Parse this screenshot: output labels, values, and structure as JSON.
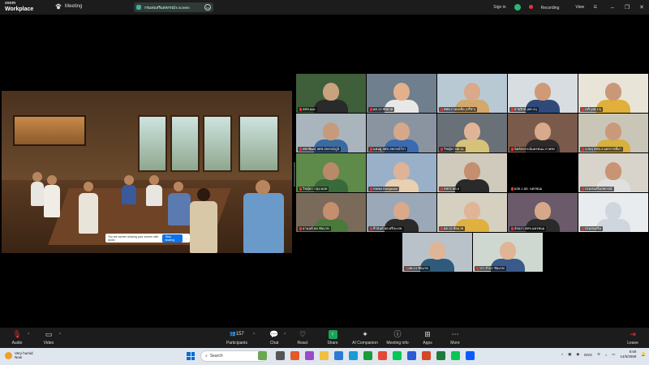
{
  "app": {
    "logo_line1": "zoom",
    "logo_line2": "Workplace",
    "meeting_tab": "Meeting",
    "share_pill_label": "กรมส่งเสริมสหกรณ์'s screen",
    "sign_in": "Sign in",
    "recording": "Recording",
    "view": "View"
  },
  "share_banner": {
    "message": "You are screen sharing your screen with audio",
    "stop_label": "Stop sharing",
    "extra": "..."
  },
  "participants": [
    {
      "name": "สศช.นผะ",
      "skin": "#c9a27e",
      "shirt": "#2a2a2a",
      "bg": "#3f5e3a"
    },
    {
      "name": "ผต.13 ชัยนาท",
      "skin": "#e2b08c",
      "shirt": "#e8e8e8",
      "bg": "#6f7f8e"
    },
    {
      "name": "ศพพ.ภาคเหนือ (ปรีชา)",
      "skin": "#d9a98a",
      "shirt": "#d4a86a",
      "bg": "#b9c9d4"
    },
    {
      "name": "สายรักษ์ (ผต.11)",
      "skin": "#d09a76",
      "shirt": "#2f4a7a",
      "bg": "#d8dde2"
    },
    {
      "name": "เบริ (ผต.13)",
      "skin": "#c99878",
      "shirt": "#e0b03a",
      "bg": "#e8e4d8"
    },
    {
      "name": "พชรพัฒน์ สศช.สหกรณ์ภูมิ",
      "skin": "#c79a7b",
      "shirt": "#3a6aa0",
      "bg": "#a9b4bd"
    },
    {
      "name": "แคนยู สศข.สหกรณ์วิรา",
      "skin": "#d6a889",
      "shirt": "#3a6ab0",
      "bg": "#8a94a0"
    },
    {
      "name": "วิชญ์ดา ผต.11",
      "skin": "#e0b496",
      "shirt": "#d7c27a",
      "bg": "#6a7078"
    },
    {
      "name": "นิตย์สหกรณ์นครพนม ภาคพร",
      "skin": "#d8a98a",
      "shirt": "#2e2a2a",
      "bg": "#7a5a4a"
    },
    {
      "name": "นายสุ สศข.4 นครราชสีมา",
      "skin": "#c99a7a",
      "shirt": "#d8b040",
      "bg": "#c9c6b8"
    },
    {
      "name": "วิชญ์ดา กลุ่ม.ผอท",
      "skin": "#b88a6a",
      "shirt": "#3a6a3a",
      "bg": "#5e8a4a"
    },
    {
      "name": "Kikitta Dongsoon",
      "skin": "#dfb397",
      "shirt": "#e8d0b0",
      "bg": "#9ab0c9"
    },
    {
      "name": "สหกร ผต.6",
      "skin": "#c48f6e",
      "shirt": "#2a2a2a",
      "bg": "#cfcabc"
    },
    {
      "name": "ผสธ.1 ผต. นครพนม",
      "skin": "#000000",
      "shirt": "#000000",
      "bg": "#000000"
    },
    {
      "name": "กรมส่งเสริมสหกรณ์",
      "skin": "#c89474",
      "shirt": "#e0e0e0",
      "bg": "#d8d4cc"
    },
    {
      "name": "อานนท์ ผต.ชัยนาท",
      "skin": "#c48f6e",
      "shirt": "#4a7a3a",
      "bg": "#7a6a5a"
    },
    {
      "name": "ธีรนันท์ ผต.ศรีสะเกษ",
      "skin": "#d8a98a",
      "shirt": "#2a2a2a",
      "bg": "#9aa8b8"
    },
    {
      "name": "ผต.13 ชัยนาท",
      "skin": "#e0b496",
      "shirt": "#e0b040",
      "bg": "#d6d0c0"
    },
    {
      "name": "อัจฉรา สศข.นครพนม",
      "skin": "#d6a889",
      "shirt": "#2a2a2a",
      "bg": "#6a5a6a"
    },
    {
      "name": "กรมส่งเสริม",
      "skin": "#cfd6de",
      "shirt": "#cfd6de",
      "bg": "#e9ecef"
    },
    {
      "name": "ผต.13 ชัยนาท",
      "skin": "#e0b496",
      "shirt": "#2f5a7a",
      "bg": "#b8c2c8"
    },
    {
      "name": "วรา สำนา ชัยนาท",
      "skin": "#e0b496",
      "shirt": "#3a5a8a",
      "bg": "#cfd8d0"
    }
  ],
  "toolbar": {
    "audio": "Audio",
    "video": "Video",
    "participants": "Participants",
    "participant_count": "157",
    "chat": "Chat",
    "react": "React",
    "share": "Share",
    "ai_companion": "AI Companion",
    "meeting_info": "Meeting info",
    "apps": "Apps",
    "more": "More",
    "leave": "Leave"
  },
  "taskbar": {
    "weather_line1": "Very humid",
    "weather_line2": "Now",
    "search_placeholder": "Search",
    "language": "ENG",
    "time": "8:59",
    "date": "14/5/2568"
  }
}
